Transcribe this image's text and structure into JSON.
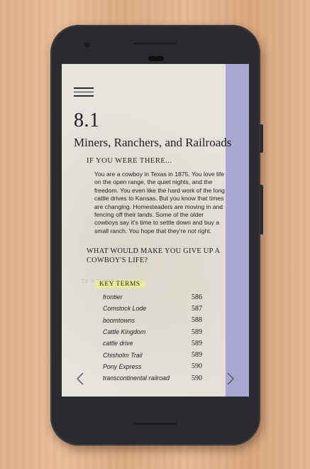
{
  "section": {
    "number": "8.1",
    "title": "Miners, Ranchers, and Railroads"
  },
  "intro": {
    "heading": "IF YOU WERE THERE...",
    "text": "You are a cowboy in Texas in 1875. You love life on the open range, the quiet nights, and the freedom. You even like the hard work of the long cattle drives to Kansas. But you know that times are changing. Homesteaders are moving in and fencing off their lands. Some of the older cowboys say it's time to settle down and buy a small ranch. You hope that they're not right."
  },
  "question": "WHAT WOULD MAKE YOU GIVE UP A COWBOY'S LIFE?",
  "faded_label": "TE          SITIONS",
  "key_terms": {
    "label": "KEY TERMS",
    "items": [
      {
        "term": "frontier",
        "page": "586"
      },
      {
        "term": "Comstock Lode",
        "page": "587"
      },
      {
        "term": "boomtowns",
        "page": "588"
      },
      {
        "term": "Cattle Kingdom",
        "page": "589"
      },
      {
        "term": "cattle drive",
        "page": "589"
      },
      {
        "term": "Chisholm Trail",
        "page": "589"
      },
      {
        "term": "Pony Express",
        "page": "590"
      },
      {
        "term": "transcontinental railroad",
        "page": "590"
      }
    ]
  },
  "icons": {
    "menu": "hamburger-menu-icon",
    "prev": "chevron-left-icon",
    "next": "chevron-right-icon"
  },
  "colors": {
    "side_strip": "#a9a6cf",
    "highlight": "#e6ea9a",
    "phone_body": "#2a2b2e"
  }
}
